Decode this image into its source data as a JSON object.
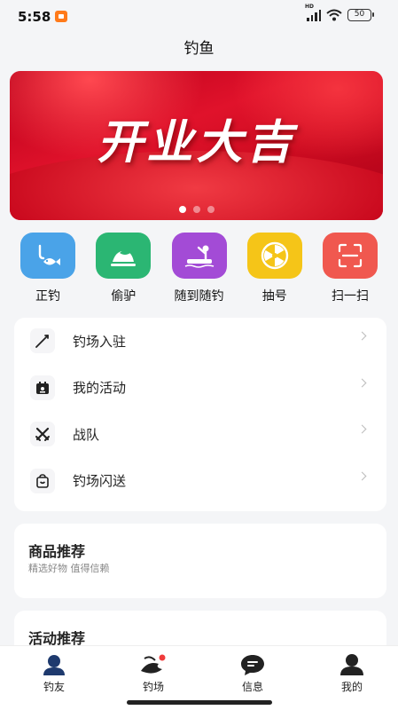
{
  "status_bar": {
    "time": "5:58",
    "battery": "50",
    "network": "HD"
  },
  "header": {
    "title": "钓鱼"
  },
  "banner": {
    "slogan": "开业大吉",
    "slides": 3,
    "active_slide": 1
  },
  "quick_actions": [
    {
      "label": "正钓",
      "icon": "fishing-icon",
      "color": "#4aa3e8"
    },
    {
      "label": "偷驴",
      "icon": "fish-island-icon",
      "color": "#2bb673"
    },
    {
      "label": "随到随钓",
      "icon": "fishing-boat-icon",
      "color": "#a34bd6"
    },
    {
      "label": "抽号",
      "icon": "wheel-icon",
      "color": "#f5c518"
    },
    {
      "label": "扫一扫",
      "icon": "scan-icon",
      "color": "#f0584f"
    }
  ],
  "menu": [
    {
      "label": "钓场入驻",
      "icon": "fishing-rod-icon"
    },
    {
      "label": "我的活动",
      "icon": "calendar-icon"
    },
    {
      "label": "战队",
      "icon": "crossed-swords-icon"
    },
    {
      "label": "钓场闪送",
      "icon": "shopping-bag-icon"
    }
  ],
  "goods_section": {
    "title": "商品推荐",
    "subtitle": "精选好物 值得信赖"
  },
  "events_section": {
    "title": "活动推荐"
  },
  "tabbar": [
    {
      "label": "钓友",
      "icon": "friends-icon",
      "active": true
    },
    {
      "label": "钓场",
      "icon": "fishing-spot-icon",
      "badge": true
    },
    {
      "label": "信息",
      "icon": "message-icon"
    },
    {
      "label": "我的",
      "icon": "profile-icon"
    }
  ]
}
